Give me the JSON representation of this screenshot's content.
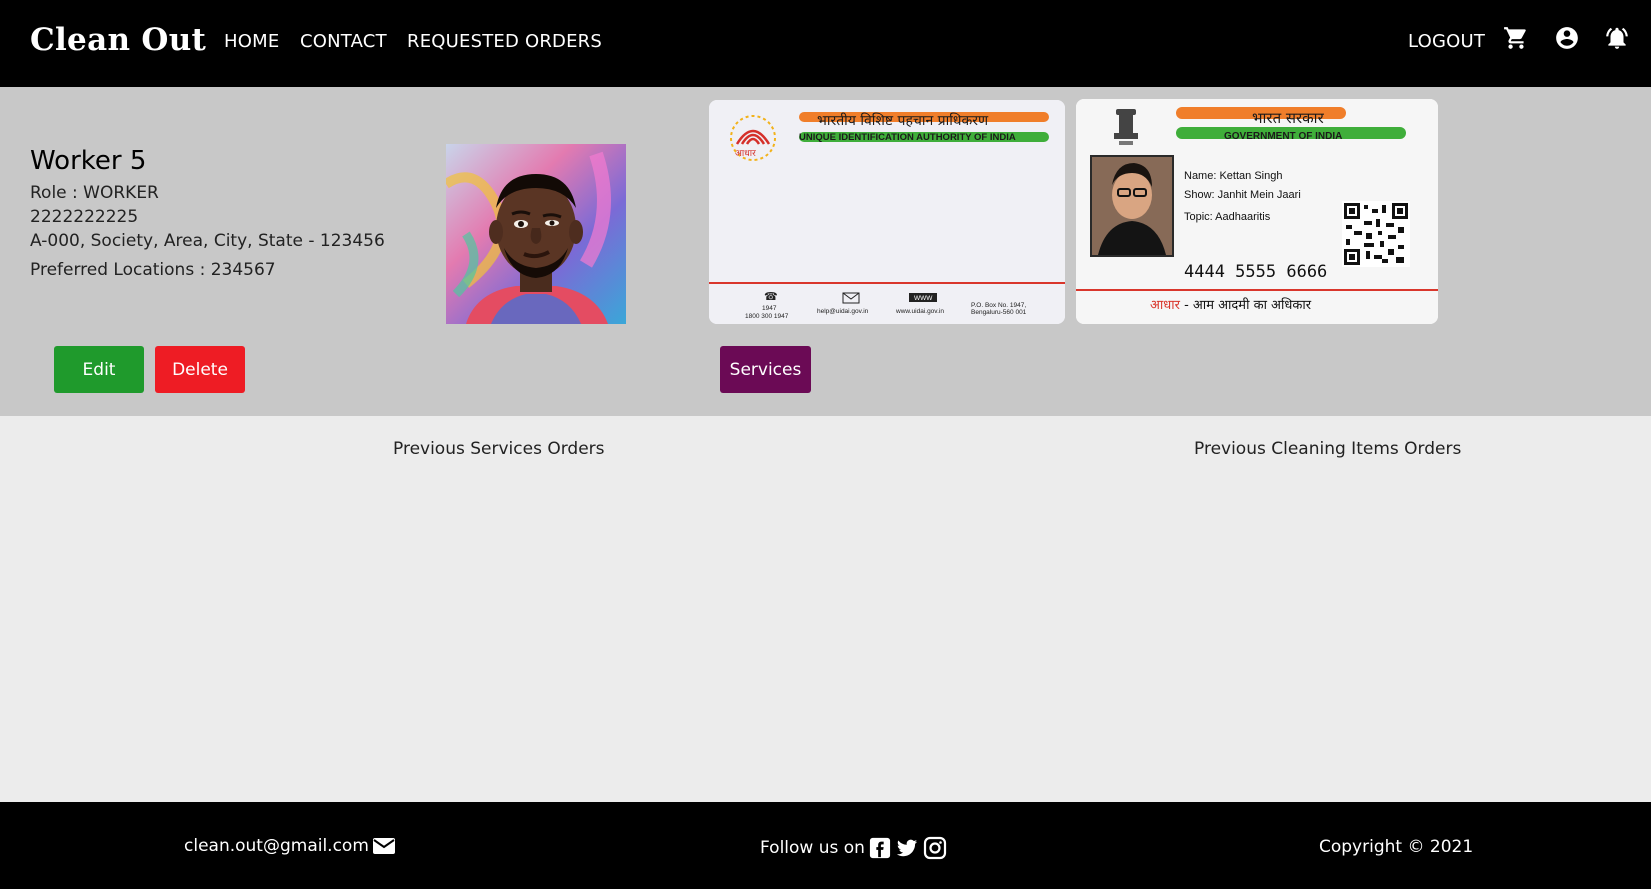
{
  "nav": {
    "brand": "Clean Out",
    "links": [
      "HOME",
      "CONTACT",
      "REQUESTED ORDERS"
    ],
    "logout": "LOGOUT",
    "icons": [
      "cart-icon",
      "account-circle-icon",
      "notification-bell-icon"
    ]
  },
  "worker": {
    "name": "Worker 5",
    "role": "Role : WORKER",
    "phone": "2222222225",
    "address": "A-000, Society, Area, City, State - 123456",
    "preferred_locations": "Preferred Locations : 234567"
  },
  "id_back": {
    "hindi_title": "भारतीय विशिष्ट पहचान प्राधिकरण",
    "english_title": "UNIQUE IDENTIFICATION AUTHORITY OF INDIA",
    "logo_text": "आधार",
    "phone_top": "1947",
    "phone_bottom": "1800 300 1947",
    "email": "help@uidai.gov.in",
    "www": "WWW",
    "website": "www.uidai.gov.in",
    "po_box": "P.O. Box No. 1947,",
    "po_city": "Bengaluru-560 001"
  },
  "id_front": {
    "hindi_title": "भारत सरकार",
    "english_title": "GOVERNMENT OF INDIA",
    "name_line": "Name: Kettan Singh",
    "show_line": "Show: Janhit Mein Jaari",
    "topic_line": "Topic: Aadhaaritis",
    "number": "4444 5555 6666",
    "footer_red": "आधार",
    "footer_text": " - आम आदमी का अधिकार"
  },
  "actions": {
    "edit": "Edit",
    "delete": "Delete",
    "services": "Services"
  },
  "orders": {
    "services_title": "Previous Services Orders",
    "items_title": "Previous Cleaning Items Orders"
  },
  "footer": {
    "email": "clean.out@gmail.com",
    "follow": "Follow us on",
    "copyright": "Copyright © 2021"
  },
  "colors": {
    "navbar": "#000000",
    "profile_band": "#c8c8c8",
    "page_bg": "#ececec",
    "edit": "#1f9a2c",
    "delete": "#ee1c24",
    "services": "#6b0a55"
  }
}
